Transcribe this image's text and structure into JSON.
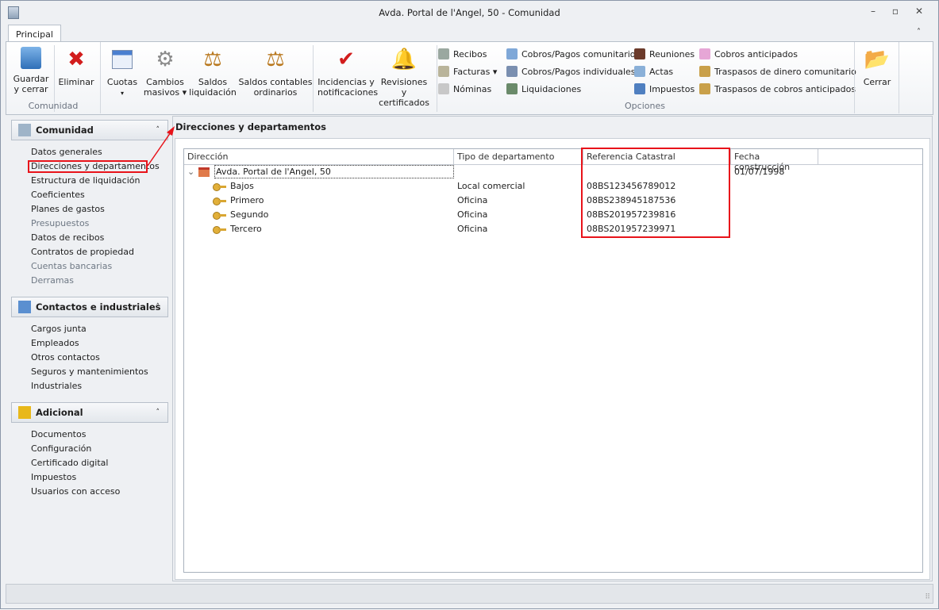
{
  "window": {
    "title": "Avda. Portal de l'Angel, 50 - Comunidad",
    "minimize": "–",
    "restore": "▫",
    "close": "✕"
  },
  "ribbon": {
    "tab": "Principal",
    "collapse": "˄",
    "groups": {
      "comunidad": "Comunidad",
      "opciones": "Opciones"
    },
    "buttons": {
      "guardar1": "Guardar",
      "guardar2": "y cerrar",
      "eliminar": "Eliminar",
      "cuotas": "Cuotas",
      "cambios1": "Cambios",
      "cambios2": "masivos ▾",
      "saldos1": "Saldos",
      "saldos2": "liquidación",
      "sco1": "Saldos contables",
      "sco2": "ordinarios",
      "inc1": "Incidencias y",
      "inc2": "notificaciones",
      "rev1": "Revisiones y",
      "rev2": "certificados",
      "cerrar": "Cerrar",
      "dropdown": "▾"
    },
    "small": [
      {
        "label": "Recibos",
        "color": "#9aa8a0"
      },
      {
        "label": "Facturas ▾",
        "color": "#b9b49a"
      },
      {
        "label": "Nóminas",
        "color": "#c8c8c8"
      },
      {
        "label": "Cobros/Pagos comunitarios",
        "color": "#7fa8d8"
      },
      {
        "label": "Cobros/Pagos individuales",
        "color": "#7a8fb0"
      },
      {
        "label": "Liquidaciones",
        "color": "#6a8a6a"
      },
      {
        "label": "Reuniones",
        "color": "#6b3a2a"
      },
      {
        "label": "Actas",
        "color": "#8ab0d8"
      },
      {
        "label": "Impuestos",
        "color": "#4f7fc0"
      },
      {
        "label": "Cobros anticipados",
        "color": "#e6a6d6"
      },
      {
        "label": "Traspasos de dinero comunitario",
        "color": "#c9a04a"
      },
      {
        "label": "Traspasos de cobros anticipados",
        "color": "#c9a04a"
      }
    ]
  },
  "sidebar": {
    "sections": [
      {
        "title": "Comunidad",
        "items": [
          {
            "label": "Datos generales",
            "dim": false
          },
          {
            "label": "Direcciones y departamentos",
            "dim": false
          },
          {
            "label": "Estructura de liquidación",
            "dim": false
          },
          {
            "label": "Coeficientes",
            "dim": false
          },
          {
            "label": "Planes de gastos",
            "dim": false
          },
          {
            "label": "Presupuestos",
            "dim": true
          },
          {
            "label": "Datos de recibos",
            "dim": false
          },
          {
            "label": "Contratos de propiedad",
            "dim": false
          },
          {
            "label": "Cuentas bancarias",
            "dim": true
          },
          {
            "label": "Derramas",
            "dim": true
          }
        ]
      },
      {
        "title": "Contactos e industriales",
        "items": [
          {
            "label": "Cargos junta"
          },
          {
            "label": "Empleados"
          },
          {
            "label": "Otros contactos"
          },
          {
            "label": "Seguros y mantenimientos"
          },
          {
            "label": "Industriales"
          }
        ]
      },
      {
        "title": "Adicional",
        "items": [
          {
            "label": "Documentos"
          },
          {
            "label": "Configuración"
          },
          {
            "label": "Certificado digital"
          },
          {
            "label": "Impuestos"
          },
          {
            "label": "Usuarios con acceso"
          }
        ]
      }
    ],
    "chevron": "˄"
  },
  "main": {
    "title": "Direcciones y departamentos",
    "columns": [
      "Dirección",
      "Tipo de departamento",
      "Referencia Catastral",
      "Fecha construcción"
    ],
    "root": {
      "name": "Avda. Portal de l'Angel, 50",
      "fecha": "01/07/1998",
      "expander": "⌄"
    },
    "rows": [
      {
        "name": "Bajos",
        "tipo": "Local comercial",
        "ref": "08BS123456789012"
      },
      {
        "name": "Primero",
        "tipo": "Oficina",
        "ref": "08BS238945187536"
      },
      {
        "name": "Segundo",
        "tipo": "Oficina",
        "ref": "08BS201957239816"
      },
      {
        "name": "Tercero",
        "tipo": "Oficina",
        "ref": "08BS201957239971"
      }
    ]
  },
  "colors": {
    "highlight": "#e8131a"
  }
}
